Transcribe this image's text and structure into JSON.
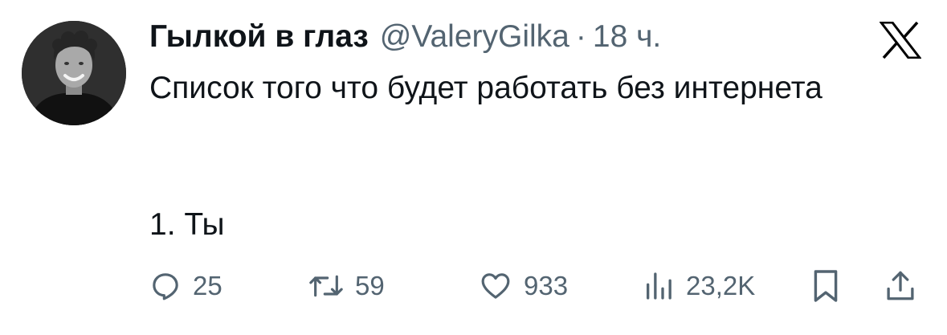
{
  "tweet": {
    "display_name": "Гылкой в глаз",
    "handle": "@ValeryGilka",
    "separator": "·",
    "time": "18 ч.",
    "text": "Список того что будет работать без интернета",
    "list_item": "1. Ты"
  },
  "actions": {
    "replies": "25",
    "retweets": "59",
    "likes": "933",
    "views": "23,2K"
  },
  "icons": {
    "avatar": "avatar-photo",
    "logo": "x-logo-icon",
    "reply": "reply-icon",
    "retweet": "retweet-icon",
    "like": "heart-icon",
    "views": "views-chart-icon",
    "bookmark": "bookmark-icon",
    "share": "share-icon"
  },
  "colors": {
    "text": "#0f1419",
    "secondary": "#536471",
    "background": "#ffffff"
  }
}
